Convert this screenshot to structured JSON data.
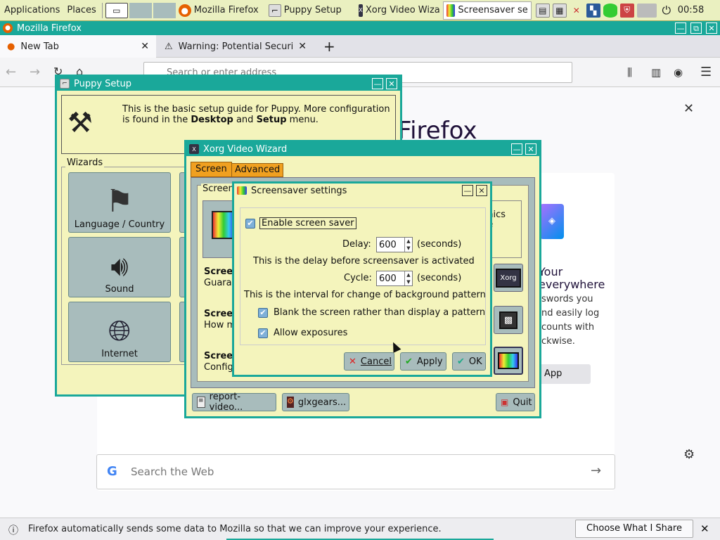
{
  "taskbar": {
    "applications": "Applications",
    "places": "Places",
    "tasks": [
      {
        "label": "Mozilla Firefox",
        "icon": "firefox-icon"
      },
      {
        "label": "Puppy Setup",
        "icon": "puppy-icon"
      },
      {
        "label": "Xorg Video Wiza",
        "icon": "xorg-icon"
      },
      {
        "label": "Screensaver se",
        "icon": "screensaver-icon"
      }
    ],
    "clock": "00:58"
  },
  "firefox": {
    "title": "Mozilla Firefox",
    "tabs": [
      {
        "label": "New Tab"
      },
      {
        "label": "Warning: Potential Securit"
      }
    ],
    "url_placeholder": "Search or enter address",
    "brand_text": "Firefox",
    "promo_heading_1": "Your",
    "promo_heading_2": "everywhere",
    "promo_body_1": "swords you",
    "promo_body_2": "nd easily log",
    "promo_body_3": "counts with",
    "promo_body_4": "ckwise.",
    "promo_button": "App",
    "search_placeholder": "Search the Web",
    "notice_text": "Firefox automatically sends some data to Mozilla so that we can improve your experience.",
    "notice_button": "Choose What I Share"
  },
  "puppy_setup": {
    "title": "Puppy Setup",
    "intro_1": "This is the basic setup guide for Puppy. More configuration",
    "intro_2a": "is found in the ",
    "intro_desktop": "Desktop",
    "intro_and": " and ",
    "intro_setup": "Setup",
    "intro_menu": " menu.",
    "wizards_label": "Wizards",
    "tiles": [
      {
        "label": "Language / Country"
      },
      {
        "label": "Sound"
      },
      {
        "label": "Internet"
      }
    ]
  },
  "xorg": {
    "title": "Xorg Video Wizard",
    "tab_screen": "Screen",
    "tab_advanced": "Advanced",
    "group_label": "Screen",
    "right_text_1": "phics",
    "right_text_2": "ne",
    "items": [
      {
        "title": "Scree",
        "sub": "Guaran"
      },
      {
        "title": "Scree",
        "sub": "How m"
      },
      {
        "title": "Scree",
        "sub": "Config"
      }
    ],
    "button_report": "report-video...",
    "button_glxgears": "glxgears...",
    "button_quit": "Quit"
  },
  "screensaver": {
    "title": "Screensaver settings",
    "enable_label": "Enable screen saver",
    "enable_checked": true,
    "delay_label": "Delay:",
    "delay_value": "600",
    "delay_unit": "(seconds)",
    "delay_desc": "This is the delay before screensaver is activated",
    "cycle_label": "Cycle:",
    "cycle_value": "600",
    "cycle_unit": "(seconds)",
    "cycle_desc": "This is the interval for change of background pattern",
    "blank_label": "Blank the screen rather than display a pattern",
    "blank_checked": true,
    "exposures_label": "Allow exposures",
    "exposures_checked": true,
    "cancel": "Cancel",
    "apply": "Apply",
    "ok": "OK"
  },
  "colors": {
    "titlebar": "#1aa89a",
    "window_bg": "#f4f4bc",
    "tab_active": "#f0a020",
    "button_bg": "#a8bcbc"
  }
}
